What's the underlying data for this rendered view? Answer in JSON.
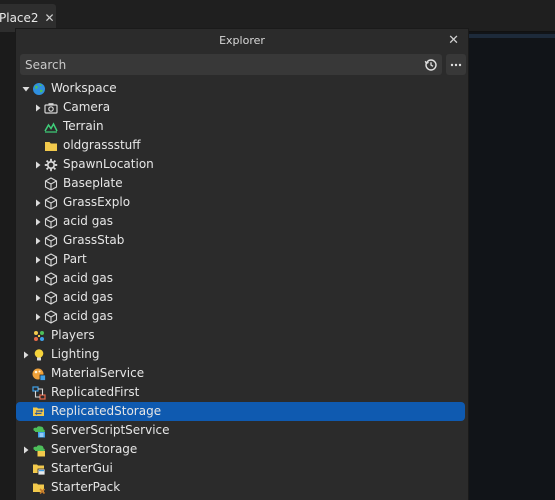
{
  "tab": {
    "label": "Place2",
    "close": "✕"
  },
  "explorer": {
    "title": "Explorer",
    "close": "✕",
    "search_placeholder": "Search",
    "more": "•••"
  },
  "tree": {
    "workspace": "Workspace",
    "camera": "Camera",
    "terrain": "Terrain",
    "oldgrass": "oldgrassstuff",
    "spawn": "SpawnLocation",
    "baseplate": "Baseplate",
    "grassexplo": "GrassExplo",
    "acidgas1": "acid gas",
    "grassstab": "GrassStab",
    "part": "Part",
    "acidgas2": "acid gas",
    "acidgas3": "acid gas",
    "acidgas4": "acid gas",
    "players": "Players",
    "lighting": "Lighting",
    "material": "MaterialService",
    "repfirst": "ReplicatedFirst",
    "repstorage": "ReplicatedStorage",
    "serverscript": "ServerScriptService",
    "serverstorage": "ServerStorage",
    "startergui": "StarterGui",
    "starterpack": "StarterPack"
  },
  "colors": {
    "selection": "#0f5ab0",
    "panel": "#2b2b2b",
    "folder": "#f2c94c"
  }
}
